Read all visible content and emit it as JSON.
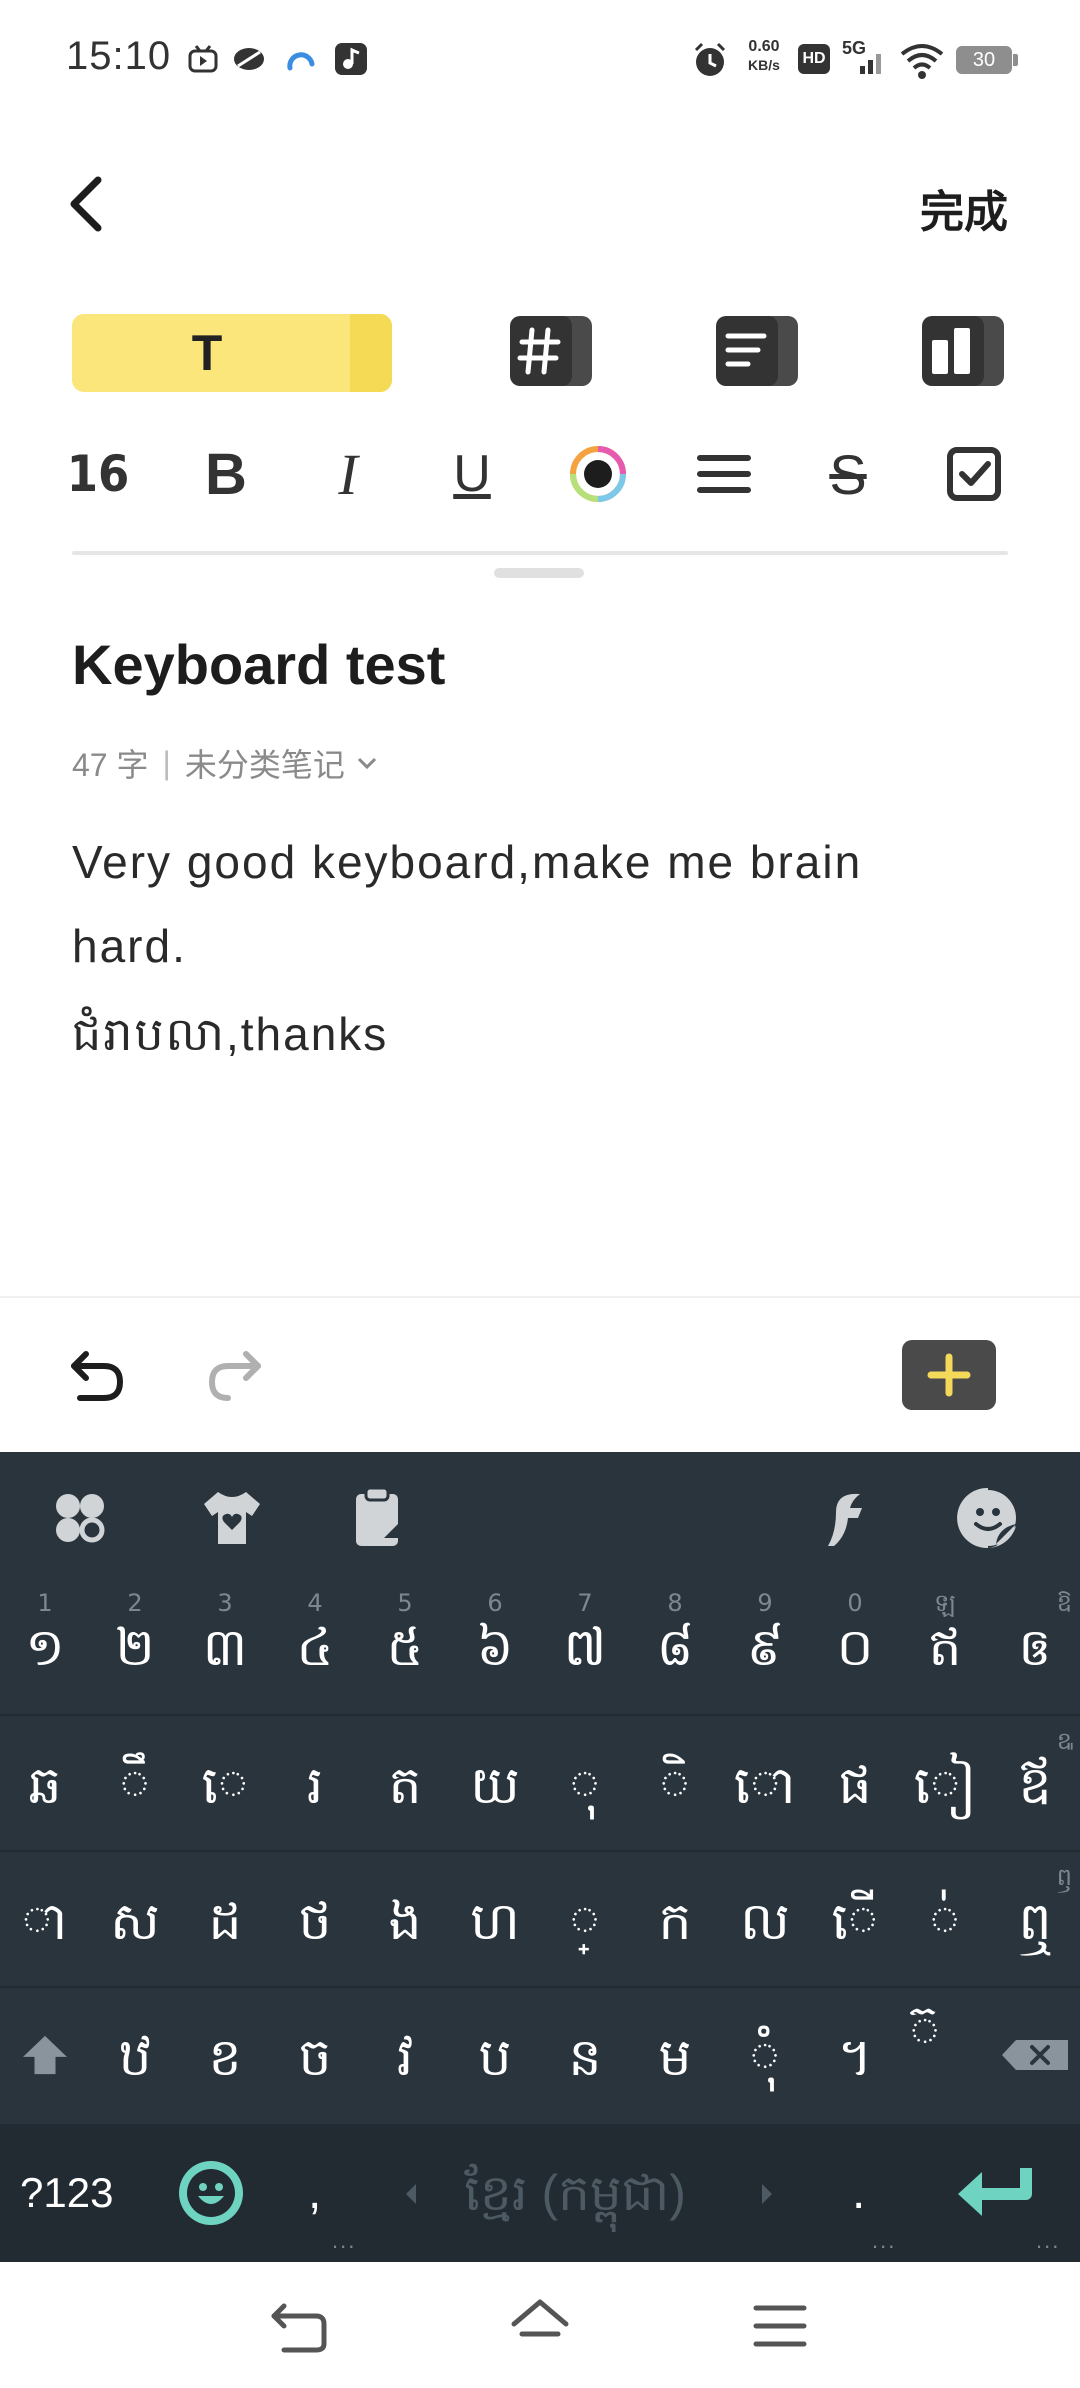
{
  "status_bar": {
    "time": "15:10",
    "net_speed_value": "0.60",
    "net_speed_unit": "KB/s",
    "hd_label": "HD",
    "network_label": "5G",
    "battery_level": "30",
    "icons": [
      "media-icon",
      "leaf-icon",
      "cloud-icon",
      "music-icon",
      "alarm-icon",
      "hd-icon",
      "signal-icon",
      "wifi-icon",
      "battery-icon"
    ]
  },
  "header": {
    "done_label": "完成"
  },
  "toolbar": {
    "text_style_label": "T",
    "font_size": "16",
    "bold_label": "B",
    "italic_label": "I",
    "underline_label": "U",
    "strike_label": "S",
    "accent_color": "#fae67a"
  },
  "note": {
    "title": "Keyboard test",
    "char_count": "47 字",
    "separator": "|",
    "category": "未分类笔记",
    "body_lines": [
      "Very good keyboard,make me brain",
      "hard.",
      "ជំរាបលា,thanks"
    ]
  },
  "keyboard": {
    "row1": [
      {
        "hint": "1",
        "label": "១"
      },
      {
        "hint": "2",
        "label": "២"
      },
      {
        "hint": "3",
        "label": "៣"
      },
      {
        "hint": "4",
        "label": "៤"
      },
      {
        "hint": "5",
        "label": "៥"
      },
      {
        "hint": "6",
        "label": "៦"
      },
      {
        "hint": "7",
        "label": "៧"
      },
      {
        "hint": "8",
        "label": "៨"
      },
      {
        "hint": "9",
        "label": "៩"
      },
      {
        "hint": "0",
        "label": "០"
      },
      {
        "hint": "ឡ",
        "label": "ឥ"
      },
      {
        "hint": "ឱ",
        "label": "ឲ"
      }
    ],
    "row2": [
      {
        "hint": "",
        "label": "ឆ"
      },
      {
        "hint": "",
        "label": "◌ឹ"
      },
      {
        "hint": "",
        "label": "◌េ"
      },
      {
        "hint": "",
        "label": "រ"
      },
      {
        "hint": "",
        "label": "ត"
      },
      {
        "hint": "",
        "label": "យ"
      },
      {
        "hint": "",
        "label": "◌ុ"
      },
      {
        "hint": "",
        "label": "◌ិ"
      },
      {
        "hint": "",
        "label": "◌ោ"
      },
      {
        "hint": "",
        "label": "ផ"
      },
      {
        "hint": "",
        "label": "◌ៀ"
      },
      {
        "hint": "ឩ",
        "label": "ឪ"
      }
    ],
    "row3": [
      {
        "hint": "",
        "label": "◌ា"
      },
      {
        "hint": "",
        "label": "ស"
      },
      {
        "hint": "",
        "label": "ដ"
      },
      {
        "hint": "",
        "label": "ថ"
      },
      {
        "hint": "",
        "label": "ង"
      },
      {
        "hint": "",
        "label": "ហ"
      },
      {
        "hint": "",
        "label": "◌្"
      },
      {
        "hint": "",
        "label": "ក"
      },
      {
        "hint": "",
        "label": "ល"
      },
      {
        "hint": "",
        "label": "◌ើ"
      },
      {
        "hint": "",
        "label": "◌់"
      },
      {
        "hint": "ឭ",
        "label": "ឮ"
      }
    ],
    "row4": [
      {
        "hint": "",
        "label": "ឋ"
      },
      {
        "hint": "",
        "label": "ខ"
      },
      {
        "hint": "",
        "label": "ច"
      },
      {
        "hint": "",
        "label": "វ"
      },
      {
        "hint": "",
        "label": "ប"
      },
      {
        "hint": "",
        "label": "ន"
      },
      {
        "hint": "",
        "label": "ម"
      },
      {
        "hint": "",
        "label": "◌ុំ"
      },
      {
        "hint": "",
        "label": "។"
      },
      {
        "hint": "",
        "label": "៊"
      }
    ],
    "symbols_label": "?123",
    "comma_label": ",",
    "space_label": "ខ្មែរ (កម្ពុជា)",
    "period_label": ".",
    "ellipsis": "...",
    "key_color": "#2a343c",
    "accent_teal": "#6fd3c2"
  }
}
